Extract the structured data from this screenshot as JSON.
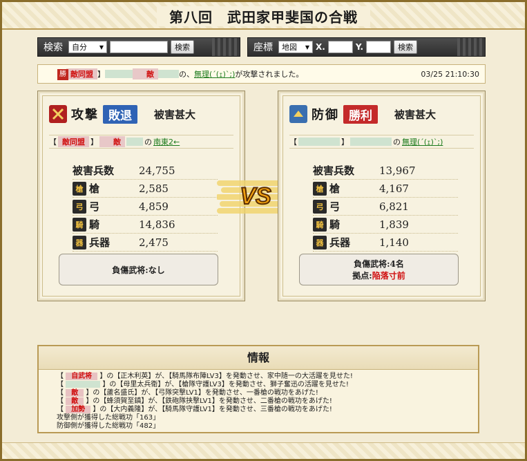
{
  "page_title": "第八回　武田家甲斐国の合戦",
  "search": {
    "label": "検索",
    "scope_selected": "自分",
    "search_value": "",
    "button": "検索"
  },
  "coords": {
    "label": "座標",
    "map_selected": "地図",
    "x_label": "X.",
    "x_value": "",
    "y_label": "Y.",
    "y_value": "",
    "button": "検索"
  },
  "notice": {
    "icon_label": "勝",
    "bracket_open": "【",
    "alliance": "敵同盟",
    "bracket_close": "】",
    "player": "敵",
    "text_mid": "の、",
    "target_link": "無理(´(ｪ)`;)",
    "text_end": "が攻撃されました。",
    "timestamp": "03/25 21:10:30"
  },
  "attack": {
    "role": "攻撃",
    "result": "敗退",
    "damage": "被害甚大",
    "alliance": "敵同盟",
    "player": "敵",
    "no": "の",
    "location_link": "南東2←",
    "header_label": "被害兵数",
    "header_value": "24,755",
    "rows": [
      {
        "label": "槍",
        "value": "2,585",
        "icon": "spear-icon"
      },
      {
        "label": "弓",
        "value": "4,859",
        "icon": "bow-icon"
      },
      {
        "label": "騎",
        "value": "14,836",
        "icon": "horse-icon"
      },
      {
        "label": "兵器",
        "value": "2,475",
        "icon": "siege-weapon-icon"
      }
    ],
    "injured": "負傷武将:なし"
  },
  "defense": {
    "role": "防御",
    "result": "勝利",
    "damage": "被害甚大",
    "no": "の",
    "location_link": "無理(´(ｪ)`;)",
    "header_label": "被害兵数",
    "header_value": "13,967",
    "rows": [
      {
        "label": "槍",
        "value": "4,167",
        "icon": "spear-icon"
      },
      {
        "label": "弓",
        "value": "6,821",
        "icon": "bow-icon"
      },
      {
        "label": "騎",
        "value": "1,839",
        "icon": "horse-icon"
      },
      {
        "label": "兵器",
        "value": "1,140",
        "icon": "siege-weapon-icon"
      }
    ],
    "injured": "負傷武将:4名",
    "fall_label": "拠点:",
    "fall_value": "陥落寸前"
  },
  "vs_label": "VS",
  "info": {
    "title": "情報",
    "line1_tag": "自武将",
    "line1_text": "の【正木利英】が、【騎馬隊布陣LV3】を発動させ、家中随一の大活躍を見せた!",
    "line2_text": "の【母里太兵衛】が、【槍隊守護LV3】を発動させ、獅子奮迅の活躍を見せた!",
    "line3_tag": "敵",
    "line3_text": "の【蘆名盛氏】が、【弓隊突撃LV1】を発動させ、一番槍の戦功をあげた!",
    "line4_tag": "敵",
    "line4_text": "の【蜂須賀至鎮】が、【鉄砲隊挟撃LV1】を発動させ、二番槍の戦功をあげた!",
    "line5_tag": "加勢",
    "line5_text": "の【大内義隆】が、【騎馬隊守護LV1】を発動させ、三番槍の戦功をあげた!",
    "line6": "攻撃側が獲得した総戦功「163」",
    "line7": "防御側が獲得した総戦功「482」"
  },
  "colors": {
    "defeat": "#2f63b5",
    "victory": "#c42a2a",
    "alert": "#d01010",
    "link": "#1b7a1b"
  }
}
